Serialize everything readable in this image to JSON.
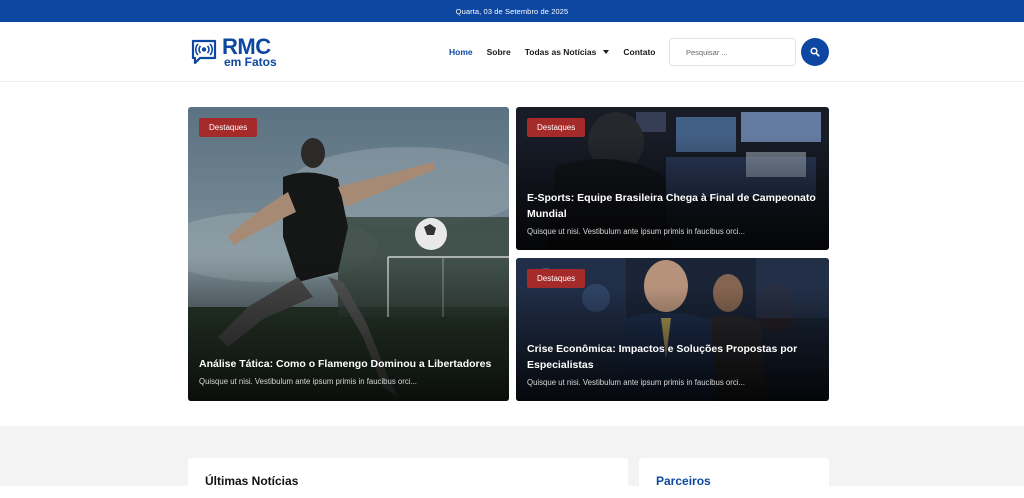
{
  "topbar": {
    "date": "Quarta, 03 de Setembro de 2025"
  },
  "logo": {
    "main": "RMC",
    "sub": "em Fatos",
    "icon": "radio-broadcast-icon"
  },
  "nav": {
    "items": [
      {
        "label": "Home",
        "active": true
      },
      {
        "label": "Sobre",
        "active": false
      },
      {
        "label": "Todas as Notícias",
        "active": false,
        "dropdown": true
      },
      {
        "label": "Contato",
        "active": false
      }
    ]
  },
  "search": {
    "placeholder": "Pesquisar ...",
    "icon": "search-icon"
  },
  "colors": {
    "brand": "#0d47a1",
    "badge": "#a52a2a"
  },
  "hero": {
    "cards": [
      {
        "badge": "Destaques",
        "title": "Análise Tática: Como o Flamengo Dominou a Libertadores",
        "excerpt": "Quisque ut nisi. Vestibulum ante ipsum primis in faucibus orci..."
      },
      {
        "badge": "Destaques",
        "title": "E-Sports: Equipe Brasileira Chega à Final de Campeonato Mundial",
        "excerpt": "Quisque ut nisi. Vestibulum ante ipsum primis in faucibus orci..."
      },
      {
        "badge": "Destaques",
        "title": "Crise Econômica: Impactos e Soluções Propostas por Especialistas",
        "excerpt": "Quisque ut nisi. Vestibulum ante ipsum primis in faucibus orci..."
      }
    ]
  },
  "sections": {
    "latest": "Últimas Notícias",
    "partners": "Parceiros"
  }
}
